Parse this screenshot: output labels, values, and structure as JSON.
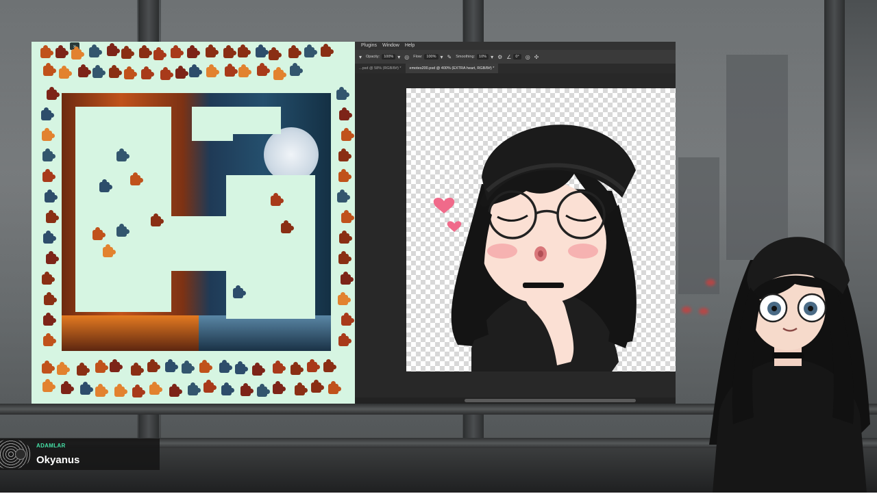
{
  "puzzle_window": {
    "collapse_glyph": "»"
  },
  "photoshop": {
    "menu": [
      "Plugins",
      "Window",
      "Help"
    ],
    "options": {
      "opacity_label": "Opacity:",
      "opacity_value": "100%",
      "flow_label": "Flow:",
      "flow_value": "100%",
      "smoothing_label": "Smoothing:",
      "smoothing_value": "10%",
      "angle_value": "0°"
    },
    "tabs": [
      "...psd @ 58% (RGB/8#) *",
      "emotes200.psd @ 400% (EXTRA heart, RGB/8#) *"
    ],
    "active_tab": 1
  },
  "now_playing": {
    "artist": "ADAMLAR",
    "title": "Okyanus"
  },
  "colors": {
    "puzzle_bg": "#d6f5e2",
    "accent_green": "#45e0a6",
    "ps_dark": "#282828"
  }
}
